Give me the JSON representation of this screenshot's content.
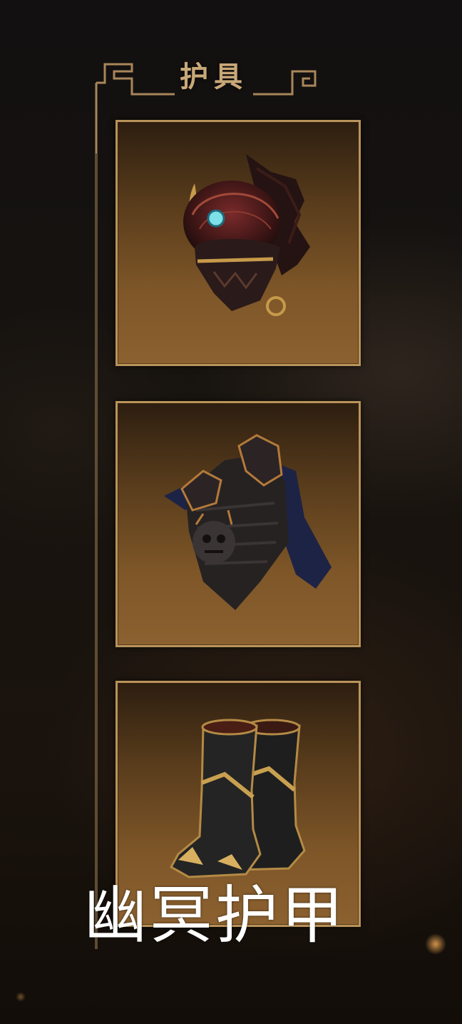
{
  "panel": {
    "title": "护具"
  },
  "equipment_slots": [
    {
      "icon": "demon-helmet-icon"
    },
    {
      "icon": "dark-chest-armor-icon"
    },
    {
      "icon": "black-gold-boots-icon"
    }
  ],
  "caption": {
    "item_name": "幽冥护甲"
  },
  "colors": {
    "frame_gold": "#b8935a",
    "title_gold": "#c9a878",
    "slot_bg": "#7e5628",
    "page_bg": "#15110d"
  }
}
